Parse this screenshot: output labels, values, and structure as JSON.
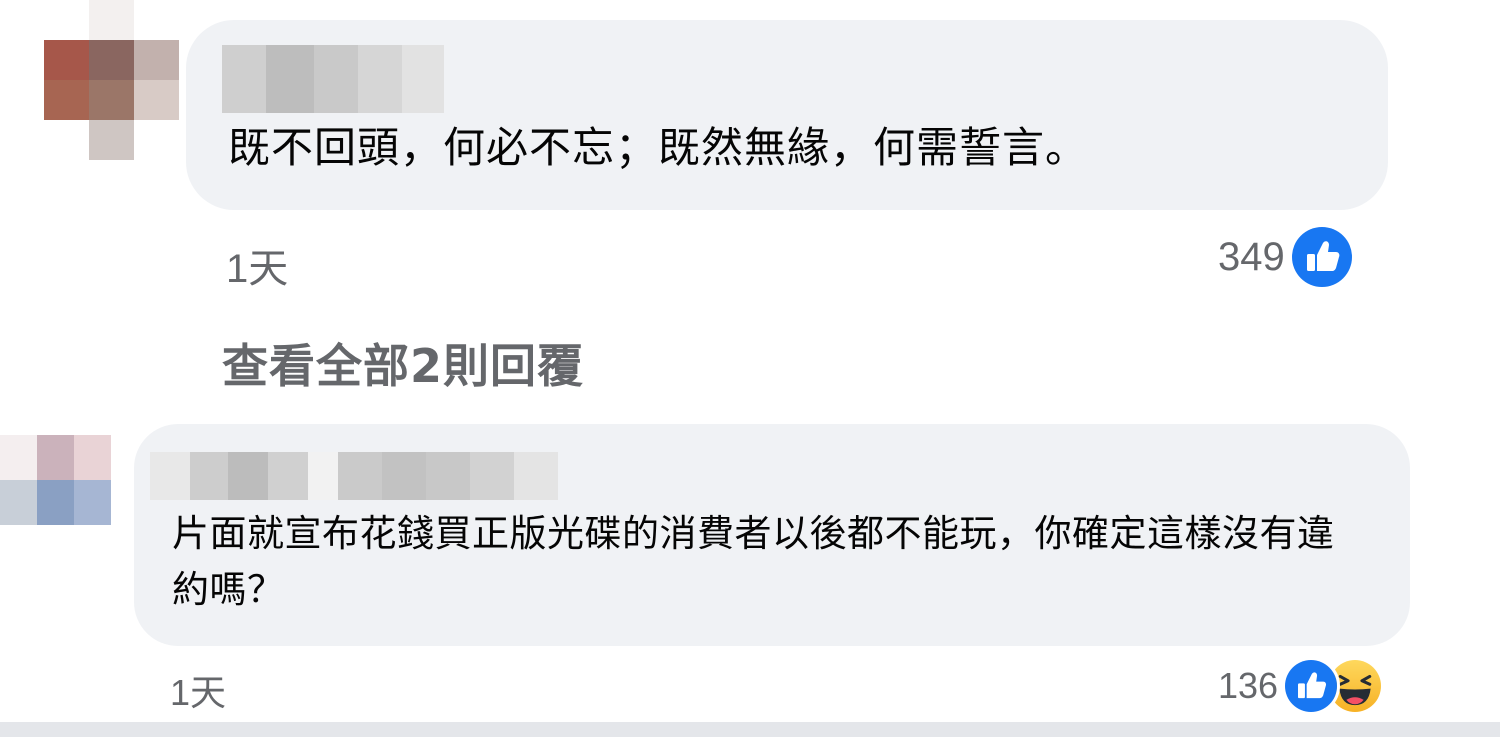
{
  "comments": [
    {
      "text": "既不回頭，何必不忘；既然無緣，何需誓言。",
      "timestamp": "1天",
      "reaction_count": "349",
      "reactions": [
        "like-icon"
      ],
      "avatar_pixels": [
        "#ffffff",
        "#f3f0ef",
        "#ffffff",
        "#a6574a",
        "#8a6660",
        "#c2b1ad",
        "#a76552",
        "#9b7668",
        "#d8cbc6",
        "#ffffff",
        "#cfc6c3",
        "#ffffff"
      ]
    },
    {
      "text": "片面就宣布花錢買正版光碟的消費者以後都不能玩，你確定這樣沒有違約嗎？",
      "timestamp": "1天",
      "reaction_count": "136",
      "reactions": [
        "like-icon",
        "haha-icon"
      ],
      "avatar_pixels": [
        "#f4eeef",
        "#cbb2bb",
        "#e9d3d6",
        "#c8cfd8",
        "#8aa0c3",
        "#a6b6d3"
      ]
    }
  ],
  "view_replies_label": "查看全部2則回覆",
  "colors": {
    "bubble": "#f0f2f5",
    "meta_text": "#65676b",
    "like_blue": "#1877f2",
    "haha_yellow": "#f7b125"
  }
}
